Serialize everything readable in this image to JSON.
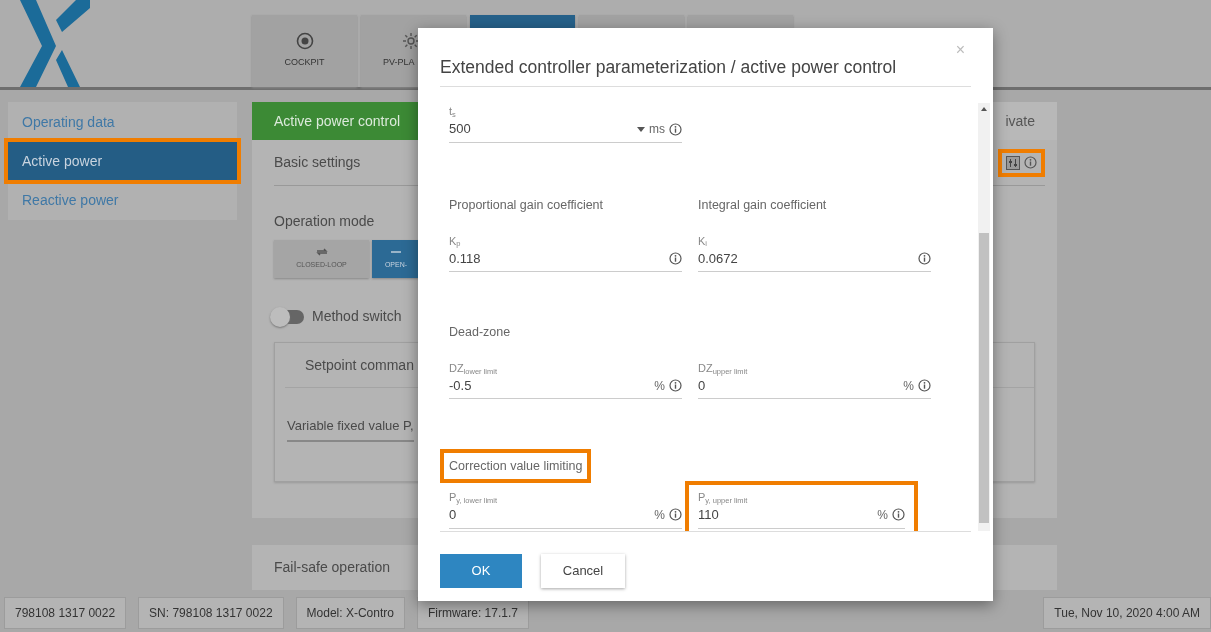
{
  "header": {
    "nav_tiles": [
      {
        "label": "COCKPIT",
        "selected": false
      },
      {
        "label": "PV-PLA",
        "selected": false
      },
      {
        "selected": true
      },
      {
        "selected": false
      },
      {
        "selected": false
      }
    ]
  },
  "sidebar": {
    "items": [
      {
        "label": "Operating data",
        "selected": false,
        "highlighted": false
      },
      {
        "label": "Active power",
        "selected": true,
        "highlighted": true
      },
      {
        "label": "Reactive power",
        "selected": false,
        "highlighted": false
      }
    ]
  },
  "main": {
    "tabs": [
      {
        "label": "Active power control",
        "selected": true
      },
      {
        "label": "ivate",
        "selected": false
      }
    ],
    "section_title": "Basic settings",
    "tools_highlighted": true,
    "operation_mode": {
      "label": "Operation mode",
      "options": [
        {
          "label": "CLOSED-LOOP",
          "selected": false
        },
        {
          "label": "OPEN-",
          "selected": true
        }
      ]
    },
    "method_switch": {
      "label": "Method switch",
      "on": false
    },
    "setpoint": {
      "title": "Setpoint comman",
      "field_label": "Variable fixed value P,"
    },
    "fail_safe_title": "Fail-safe operation"
  },
  "status_bar": {
    "items": [
      "798108 1317 0022",
      "SN: 798108 1317 0022",
      "Model: X-Contro",
      "Firmware: 17.1.7"
    ],
    "datetime": "Tue, Nov 10, 2020 4:00 AM"
  },
  "dialog": {
    "title": "Extended controller parameterization / active power control",
    "close": "×",
    "rows": [
      {
        "headings": [],
        "fields": [
          {
            "label": "t$_{s}$",
            "value": "500",
            "kind": "dropdown",
            "unit": "ms",
            "highlighted": false
          }
        ]
      },
      {
        "headings": [
          {
            "text": "Proportional gain coefficient",
            "highlighted": false
          },
          {
            "text": "Integral gain coefficient",
            "highlighted": false
          }
        ],
        "fields": [
          {
            "label": "K$_{p}$",
            "value": "0.118",
            "kind": "text",
            "highlighted": false
          },
          {
            "label": "K$_{i}$",
            "value": "0.0672",
            "kind": "text",
            "highlighted": false
          }
        ]
      },
      {
        "headings": [
          {
            "text": "Dead-zone",
            "highlighted": false
          }
        ],
        "fields": [
          {
            "label": "DZ$_{lower limit}$",
            "value": "-0.5",
            "kind": "text",
            "unit": "%",
            "highlighted": false
          },
          {
            "label": "DZ$_{upper limit}$",
            "value": "0",
            "kind": "text",
            "unit": "%",
            "highlighted": false
          }
        ]
      },
      {
        "headings": [
          {
            "text": "Correction value limiting",
            "highlighted": true
          }
        ],
        "fields": [
          {
            "label": "P$_{y, lower limit}$",
            "value": "0",
            "kind": "text",
            "unit": "%",
            "highlighted": false
          },
          {
            "label": "P$_{y, upper limit}$",
            "value": "110",
            "kind": "text",
            "unit": "%",
            "highlighted": true
          }
        ]
      }
    ],
    "buttons": [
      {
        "label": "OK",
        "kind": "primary"
      },
      {
        "label": "Cancel",
        "kind": "secondary"
      }
    ]
  }
}
